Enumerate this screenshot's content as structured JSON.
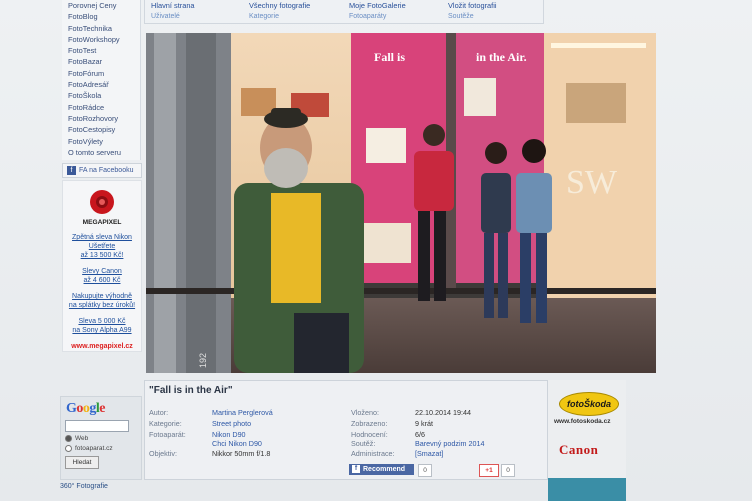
{
  "left_nav": [
    "Porovnej Ceny",
    "FotoBlog",
    "FotoTechnika",
    "FotoWorkshopy",
    "FotoTest",
    "FotoBazar",
    "FotoFórum",
    "FotoAdresář",
    "FotoŠkola",
    "FotoRádce",
    "FotoRozhovory",
    "FotoCestopisy",
    "FotoVýlety",
    "O tomto serveru"
  ],
  "facebook_label": "FA na Facebooku",
  "ad": {
    "brand": "MEGAPIXEL",
    "promos": [
      [
        "Zpětná sleva Nikon",
        "Ušetřete",
        "až 13 500 Kč!"
      ],
      [
        "Slevy Canon",
        "až 4 600 Kč"
      ],
      [
        "Nakupujte výhodně",
        "na splátky bez úroků!"
      ],
      [
        "Sleva 5 000 Kč",
        "na Sony Alpha A99"
      ]
    ],
    "url": "www.megapixel.cz"
  },
  "google": {
    "logo": "Google",
    "radio_web": "Web",
    "radio_site": "fotoaparat.cz",
    "search_button": "Hledat"
  },
  "footer_link": "360° Fotografie",
  "top_nav": [
    {
      "main": "Hlavní strana",
      "sub": "Uživatelé"
    },
    {
      "main": "Všechny fotografie",
      "sub": "Kategorie"
    },
    {
      "main": "Moje FotoGalerie",
      "sub": "Fotoaparáty"
    },
    {
      "main": "Vložit fotografii",
      "sub": "Soutěže"
    }
  ],
  "photo": {
    "sign_left": "Fall is",
    "sign_right": "in the Air.",
    "window_text": "SW",
    "corner_number": "192"
  },
  "info": {
    "title": "\"Fall is in the Air\"",
    "author_label": "Autor:",
    "author": "Martina Perglerová",
    "category_label": "Kategorie:",
    "category": "Street photo",
    "camera_label": "Fotoaparát:",
    "camera": "Nikon D90",
    "camera_want": "Chci Nikon D90",
    "lens_label": "Objektiv:",
    "lens": "Nikkor 50mm f/1.8",
    "inserted_label": "Vloženo:",
    "inserted": "22.10.2014 19:44",
    "shown_label": "Zobrazeno:",
    "shown": "9 krát",
    "rating_label": "Hodnocení:",
    "rating": "6/6",
    "contest_label": "Soutěž:",
    "contest": "Barevný podzim 2014",
    "admin_label": "Administrace:",
    "admin": "[Smazat]",
    "recommend": "Recommend",
    "recommend_count": "0",
    "gplus": "+1",
    "gplus_count": "0"
  },
  "right_ad": {
    "foto_skoda": "fotoŠkoda",
    "foto_skoda_url": "www.fotoskoda.cz",
    "canon": "Canon"
  }
}
